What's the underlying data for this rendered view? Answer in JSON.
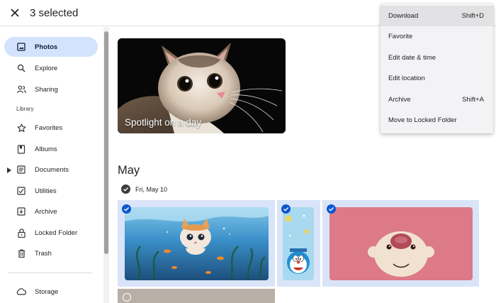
{
  "header": {
    "selected_text": "3 selected"
  },
  "sidebar": {
    "items": [
      {
        "label": "Photos",
        "icon": "photo-icon",
        "active": true
      },
      {
        "label": "Explore",
        "icon": "search-icon"
      },
      {
        "label": "Sharing",
        "icon": "people-icon"
      }
    ],
    "library_label": "Library",
    "library_items": [
      {
        "label": "Favorites",
        "icon": "star-icon"
      },
      {
        "label": "Albums",
        "icon": "album-icon"
      },
      {
        "label": "Documents",
        "icon": "document-icon"
      },
      {
        "label": "Utilities",
        "icon": "utilities-icon"
      },
      {
        "label": "Archive",
        "icon": "archive-icon"
      },
      {
        "label": "Locked Folder",
        "icon": "lock-icon"
      },
      {
        "label": "Trash",
        "icon": "trash-icon"
      }
    ],
    "storage_label": "Storage"
  },
  "main": {
    "spotlight_title": "Spotlight on a day",
    "month": "May",
    "date_label": "Fri, May 10"
  },
  "menu": {
    "items": [
      {
        "label": "Download",
        "shortcut": "Shift+D"
      },
      {
        "label": "Favorite",
        "shortcut": ""
      },
      {
        "label": "Edit date & time",
        "shortcut": ""
      },
      {
        "label": "Edit location",
        "shortcut": ""
      },
      {
        "label": "Archive",
        "shortcut": "Shift+A"
      },
      {
        "label": "Move to Locked Folder",
        "shortcut": ""
      }
    ]
  },
  "colors": {
    "accent": "#0b57d0",
    "active_nav": "#d3e3fd",
    "selected_tile_bg": "#d9e4f8"
  }
}
